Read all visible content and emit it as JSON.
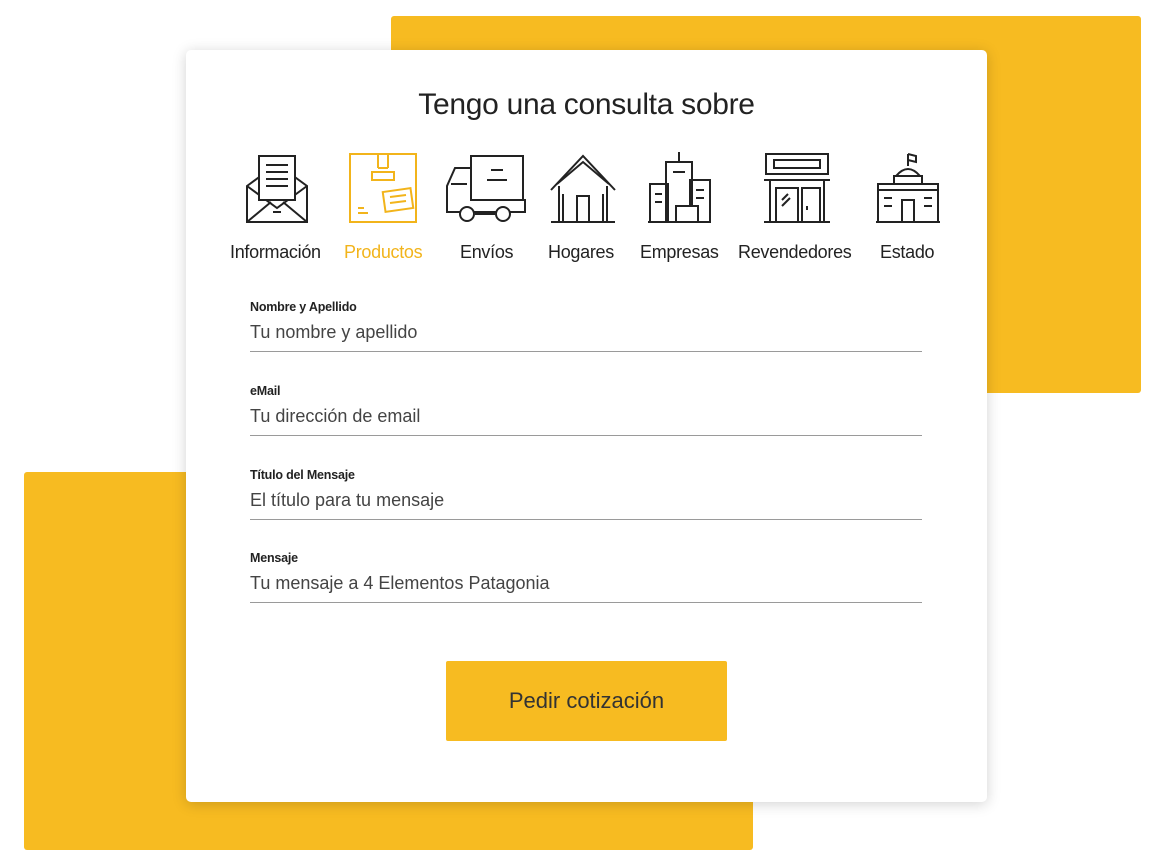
{
  "form": {
    "title": "Tengo una consulta sobre",
    "categories": [
      {
        "label": "Información",
        "icon": "open-envelope-icon",
        "active": false
      },
      {
        "label": "Productos",
        "icon": "package-box-icon",
        "active": true
      },
      {
        "label": "Envíos",
        "icon": "delivery-truck-icon",
        "active": false
      },
      {
        "label": "Hogares",
        "icon": "house-icon",
        "active": false
      },
      {
        "label": "Empresas",
        "icon": "office-buildings-icon",
        "active": false
      },
      {
        "label": "Revendedores",
        "icon": "storefront-icon",
        "active": false
      },
      {
        "label": "Estado",
        "icon": "government-building-icon",
        "active": false
      }
    ],
    "fields": {
      "name": {
        "label": "Nombre y Apellido",
        "placeholder": "Tu nombre y apellido"
      },
      "email": {
        "label": "eMail",
        "placeholder": "Tu dirección de email"
      },
      "subject": {
        "label": "Título del Mensaje",
        "placeholder": "El título para tu mensaje"
      },
      "message": {
        "label": "Mensaje",
        "placeholder": "Tu mensaje a 4 Elementos Patagonia"
      }
    },
    "submit_label": "Pedir cotización"
  },
  "colors": {
    "accent": "#f7bb21",
    "active_label": "#f2b41b",
    "text": "#222222",
    "underline": "#9a9a9a"
  }
}
